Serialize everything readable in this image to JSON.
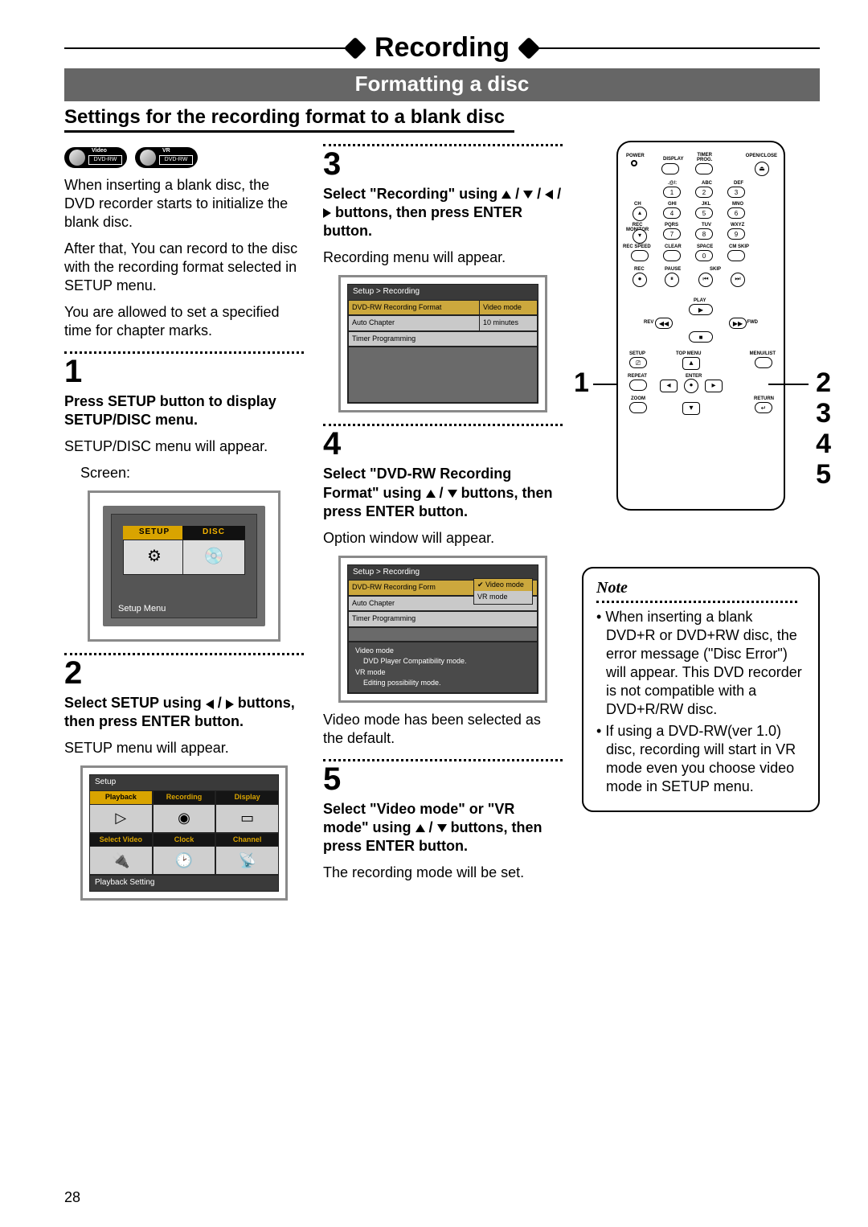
{
  "header": {
    "title": "Recording",
    "sectionBar": "Formatting a disc",
    "subheading": "Settings for the recording format to a blank disc"
  },
  "badges": {
    "video": {
      "top": "Video",
      "text": "DVD-RW"
    },
    "vr": {
      "top": "VR",
      "text": "DVD-RW"
    }
  },
  "intro": {
    "p1": "When inserting a blank disc, the DVD recorder starts to initialize the blank disc.",
    "p2": "After that, You can record to the disc with the recording format selected in SETUP menu.",
    "p3": "You are allowed to set a specified time for chapter marks."
  },
  "step1": {
    "num": "1",
    "bold": "Press SETUP button to display SETUP/DISC menu.",
    "text": "SETUP/DISC menu will appear.",
    "indent": "Screen:",
    "tv": {
      "setup": "SETUP",
      "disc": "DISC",
      "caption": "Setup Menu"
    }
  },
  "step2": {
    "num": "2",
    "bold_a": "Select SETUP using ",
    "bold_b": " buttons, then press ENTER button.",
    "text": "SETUP menu will appear.",
    "menu": {
      "head": "Setup",
      "tiles": [
        "Playback",
        "Recording",
        "Display",
        "Select Video",
        "Clock",
        "Channel"
      ],
      "foot": "Playback Setting"
    }
  },
  "step3": {
    "num": "3",
    "bold_a": "Select \"Recording\" using ",
    "bold_b": " buttons, then press ENTER button.",
    "text": "Recording menu will appear.",
    "rec": {
      "head": "Setup > Recording",
      "r1l": "DVD-RW Recording Format",
      "r1v": "Video mode",
      "r2l": "Auto Chapter",
      "r2v": "10 minutes",
      "r3l": "Timer Programming"
    }
  },
  "step4": {
    "num": "4",
    "bold_a": "Select \"DVD-RW Recording Format\" using ",
    "bold_b": " buttons, then press ENTER button.",
    "text": "Option window will appear.",
    "opt": {
      "head": "Setup > Recording",
      "r1l": "DVD-RW Recording Form",
      "r2l": "Auto Chapter",
      "r3l": "Timer Programming",
      "pop1": "Video mode",
      "pop2": "VR mode",
      "d1": "Video mode",
      "d1s": "DVD Player Compatibility mode.",
      "d2": "VR mode",
      "d2s": "Editing possibility mode."
    },
    "after": "Video mode has been selected as the default."
  },
  "step5": {
    "num": "5",
    "bold_a": "Select \"Video mode\" or \"VR mode\" using ",
    "bold_b": " buttons, then press ENTER button.",
    "text": "The recording mode will be set."
  },
  "remote": {
    "labels": {
      "power": "POWER",
      "display": "DISPLAY",
      "timerprog": "TIMER\nPROG.",
      "openclose": "OPEN/CLOSE",
      "audio": ".@/:",
      "abc": "ABC",
      "def": "DEF",
      "ch": "CH",
      "ghi": "GHI",
      "jkl": "JKL",
      "mno": "MNO",
      "recmon": "REC\nMONITOR",
      "pqrs": "PQRS",
      "tuv": "TUV",
      "wxyz": "WXYZ",
      "recspeed": "REC SPEED",
      "clear": "CLEAR",
      "space": "SPACE",
      "cmskip": "CM SKIP",
      "rec": "REC",
      "pause": "PAUSE",
      "skip": "SKIP",
      "play": "PLAY",
      "rev": "REV",
      "fwd": "FWD",
      "stop": "STOP",
      "setup": "SETUP",
      "topmenu": "TOP MENU",
      "menulist": "MENU/LIST",
      "repeat": "REPEAT",
      "enter": "ENTER",
      "zoom": "ZOOM",
      "return": "RETURN"
    },
    "callouts": {
      "left": "1",
      "r2": "2",
      "r3": "3",
      "r4": "4",
      "r5": "5"
    }
  },
  "note": {
    "title": "Note",
    "li1": "When inserting a blank DVD+R or DVD+RW disc, the error message (\"Disc Error\") will appear. This DVD recorder is not compatible with a DVD+R/RW disc.",
    "li2": "If using a DVD-RW(ver 1.0) disc, recording will start in VR mode even you choose video mode in SETUP menu."
  },
  "pageNumber": "28"
}
